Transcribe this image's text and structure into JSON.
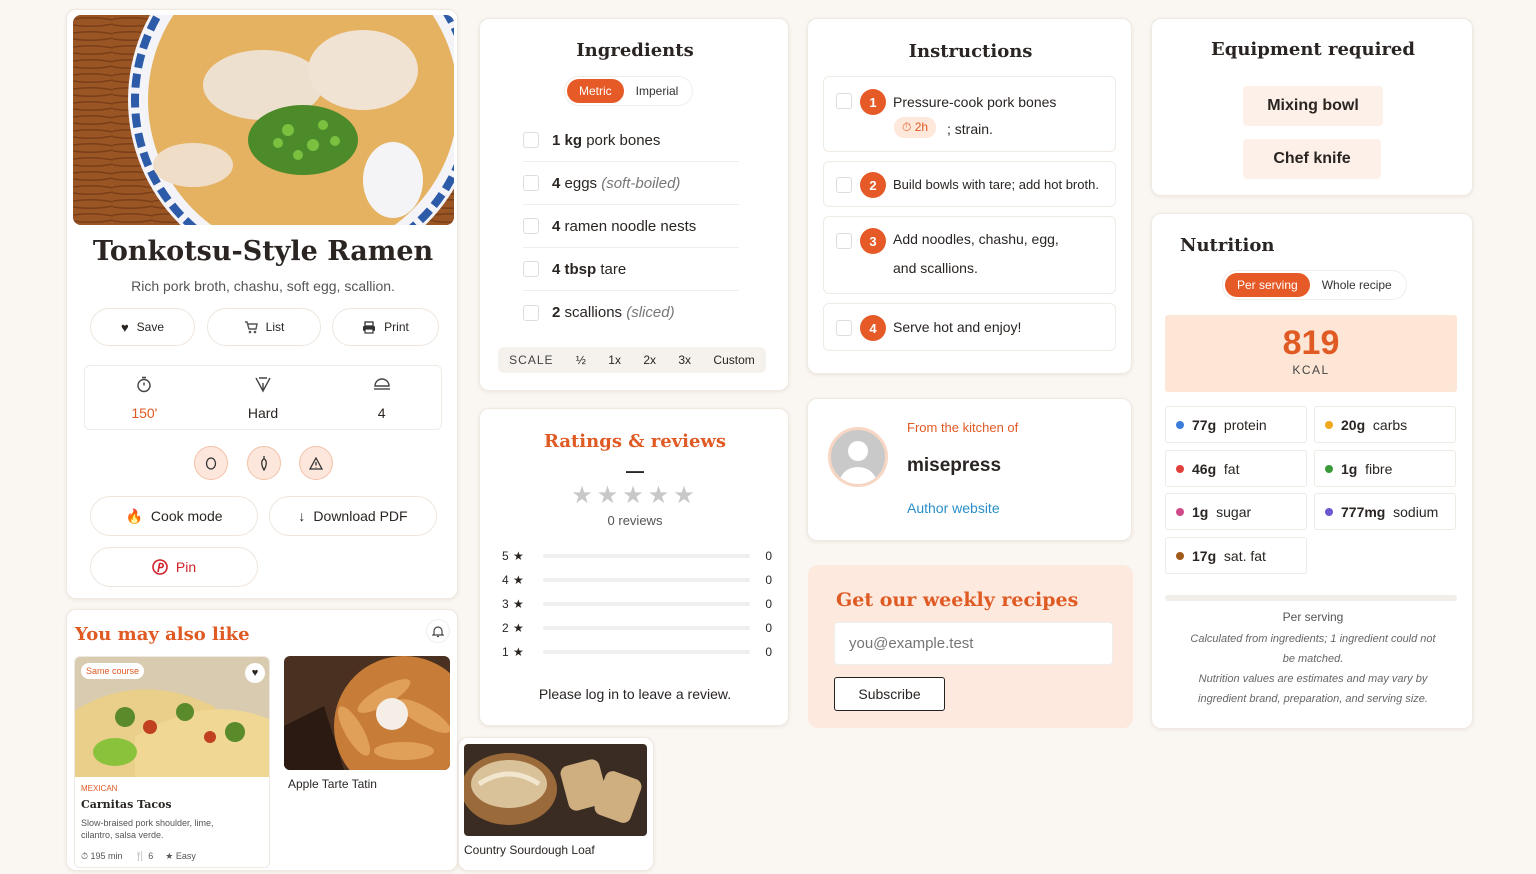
{
  "recipe": {
    "title": "Tonkotsu-Style Ramen",
    "subtitle": "Rich pork broth, chashu, soft egg, scallion.",
    "actions": [
      "Save",
      "List",
      "Print"
    ],
    "stats": [
      {
        "icon": "timer-icon",
        "value": "150'"
      },
      {
        "icon": "difficulty-icon",
        "value": "Hard"
      },
      {
        "icon": "servings-icon",
        "value": "4"
      }
    ],
    "cook_mode": "Cook mode",
    "download_pdf": "Download PDF",
    "pin": "Pin"
  },
  "ingredients": {
    "title": "Ingredients",
    "units": [
      "Metric",
      "Imperial"
    ],
    "items": [
      {
        "qty": "1 kg",
        "name": "pork bones",
        "note": ""
      },
      {
        "qty": "4",
        "name": "eggs",
        "note": "(soft-boiled)"
      },
      {
        "qty": "4",
        "name": "ramen noodle nests",
        "note": ""
      },
      {
        "qty": "4 tbsp",
        "name": "tare",
        "note": ""
      },
      {
        "qty": "2",
        "name": "scallions",
        "note": "(sliced)"
      }
    ],
    "scale_label": "SCALE",
    "scale_options": [
      "½",
      "1x",
      "2x",
      "3x",
      "Custom"
    ]
  },
  "instructions": {
    "title": "Instructions",
    "steps": [
      {
        "n": "1",
        "text": "Pressure-cook pork bones",
        "timer": "2h",
        "after": "; strain."
      },
      {
        "n": "2",
        "text": "Build bowls with tare; add hot broth."
      },
      {
        "n": "3",
        "text": "Add noodles, chashu, egg,",
        "text2": "and scallions."
      },
      {
        "n": "4",
        "text": "Serve hot and enjoy!"
      }
    ]
  },
  "equipment": {
    "title": "Equipment required",
    "items": [
      "Mixing bowl",
      "Chef knife"
    ]
  },
  "nutrition": {
    "title": "Nutrition",
    "toggle": [
      "Per serving",
      "Whole recipe"
    ],
    "kcal": "819",
    "kcal_label": "KCAL",
    "items": [
      {
        "v": "77g",
        "l": "protein",
        "c": "#3b7dd8"
      },
      {
        "v": "20g",
        "l": "carbs",
        "c": "#f0a81c"
      },
      {
        "v": "46g",
        "l": "fat",
        "c": "#e0403a"
      },
      {
        "v": "1g",
        "l": "fibre",
        "c": "#3a9a3a"
      },
      {
        "v": "1g",
        "l": "sugar",
        "c": "#d04a8a"
      },
      {
        "v": "777mg",
        "l": "sodium",
        "c": "#6a5ad0"
      },
      {
        "v": "17g",
        "l": "sat. fat",
        "c": "#a05a1a"
      }
    ],
    "footer_title": "Per serving",
    "note1": "Calculated from ingredients; 1 ingredient could not",
    "note2": "be matched.",
    "note3": "Nutrition values are estimates and may vary by",
    "note4": "ingredient brand, preparation, and serving size."
  },
  "ratings": {
    "title": "Ratings & reviews",
    "avg": "—",
    "count": "0 reviews",
    "rows": [
      {
        "star": "5",
        "count": "0"
      },
      {
        "star": "4",
        "count": "0"
      },
      {
        "star": "3",
        "count": "0"
      },
      {
        "star": "2",
        "count": "0"
      },
      {
        "star": "1",
        "count": "0"
      }
    ],
    "login": "Please log in to leave a review."
  },
  "author": {
    "from": "From the kitchen of",
    "name": "misepress",
    "website": "Author website"
  },
  "newsletter": {
    "title": "Get our weekly recipes",
    "placeholder": "you@example.test",
    "button": "Subscribe"
  },
  "related": {
    "title": "You may also like",
    "cards": [
      {
        "badge": "Same course",
        "category": "MEXICAN",
        "title": "Carnitas Tacos",
        "desc1": "Slow-braised pork shoulder, lime,",
        "desc2": "cilantro, salsa verde.",
        "time": "195 min",
        "servings": "6",
        "level": "Easy"
      },
      {
        "title": "Apple Tarte Tatin"
      },
      {
        "title": "Country Sourdough Loaf"
      }
    ]
  },
  "colors": {
    "accent": "#e55a27",
    "background": "#faf6f1",
    "kcal_bg": "#fde6d6"
  }
}
